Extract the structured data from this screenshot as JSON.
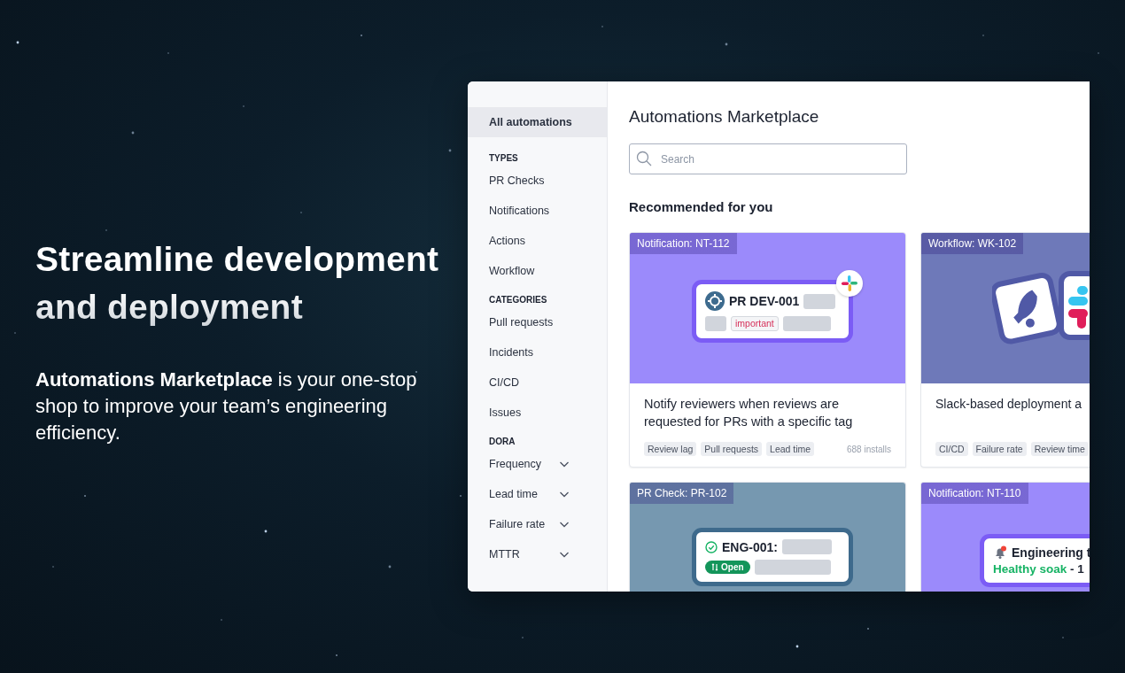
{
  "hero": {
    "title": "Streamline development and deployment",
    "description": "**Automations Marketplace** is your one-stop shop to improve your team’s engineering efficiency."
  },
  "sidebar": {
    "items": [
      {
        "kind": "item",
        "label": "All automations",
        "selected": true
      },
      {
        "kind": "heading",
        "label": "TYPES"
      },
      {
        "kind": "item",
        "label": "PR Checks",
        "selected": false
      },
      {
        "kind": "item",
        "label": "Notifications",
        "selected": false
      },
      {
        "kind": "item",
        "label": "Actions",
        "selected": false
      },
      {
        "kind": "item",
        "label": "Workflow",
        "selected": false
      },
      {
        "kind": "heading",
        "label": "CATEGORIES"
      },
      {
        "kind": "item",
        "label": "Pull requests",
        "selected": false
      },
      {
        "kind": "item",
        "label": "Incidents",
        "selected": false
      },
      {
        "kind": "item",
        "label": "CI/CD",
        "selected": false
      },
      {
        "kind": "item",
        "label": "Issues",
        "selected": false
      },
      {
        "kind": "heading",
        "label": "DORA"
      },
      {
        "kind": "dropdown",
        "label": "Frequency",
        "selected": false,
        "expanded": false
      },
      {
        "kind": "dropdown",
        "label": "Lead time",
        "selected": false,
        "expanded": false
      },
      {
        "kind": "dropdown",
        "label": "Failure rate",
        "selected": false,
        "expanded": false
      },
      {
        "kind": "dropdown",
        "label": "MTTR",
        "selected": false,
        "expanded": false
      }
    ]
  },
  "main": {
    "title": "Automations Marketplace",
    "search": {
      "placeholder": "Search"
    },
    "section_title": "Recommended for you",
    "cards": [
      {
        "tag": "Notification: NT-112",
        "color": "#9b8afb",
        "illustration": {
          "kind": "pr",
          "id": "PR DEV-001",
          "label": "important"
        },
        "title": "Notify reviewers when reviews are requested for PRs with a specific tag",
        "tags": [
          "Review lag",
          "Pull requests",
          "Lead time"
        ],
        "installs": "688 installs"
      },
      {
        "tag": "Workflow: WK-102",
        "color": "#6e79b9",
        "illustration": {
          "kind": "apps"
        },
        "title": "Slack-based deployment a",
        "tags": [
          "CI/CD",
          "Failure rate",
          "Review time"
        ]
      },
      {
        "tag": "PR Check: PR-102",
        "color": "#7698b0",
        "illustration": {
          "kind": "check",
          "id": "ENG-001:",
          "status": "Open"
        }
      },
      {
        "tag": "Notification: NT-110",
        "color": "#9b8afb",
        "illustration": {
          "kind": "alert",
          "title": "Engineering t",
          "status": "Healthy soak",
          "detail": "- 1"
        }
      }
    ]
  }
}
